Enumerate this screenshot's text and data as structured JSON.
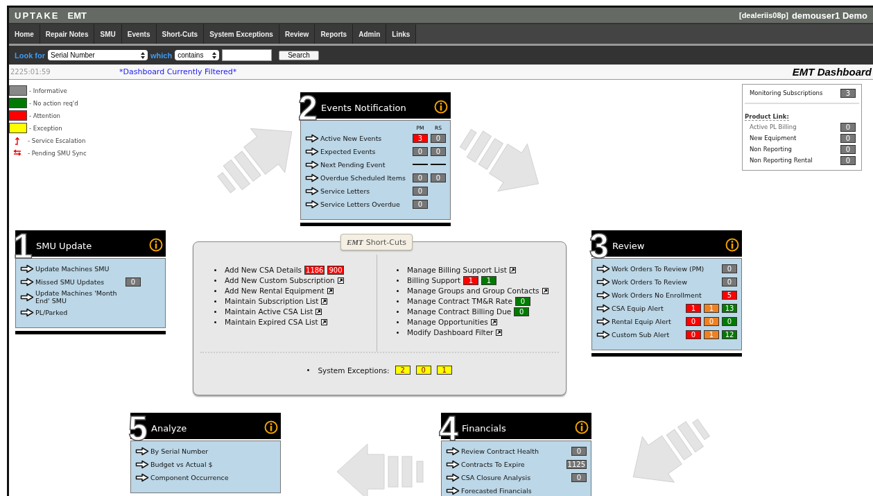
{
  "top_bar": {
    "logo": "UPTAKE",
    "product": "EMT",
    "account": "[dealeriis08p]",
    "user": "demouser1 Demo"
  },
  "nav": [
    "Home",
    "Repair Notes",
    "SMU",
    "Events",
    "Short-Cuts",
    "System Exceptions",
    "Review",
    "Reports",
    "Admin",
    "Links"
  ],
  "search": {
    "look_for_label": "Look for",
    "field": "Serial Number",
    "which_label": "which",
    "operator": "contains",
    "button": "Search"
  },
  "info_bar": {
    "time": "2225:01:59",
    "filter_notice": "*Dashboard Currently Filtered*",
    "title": "EMT Dashboard"
  },
  "legend": [
    {
      "kind": "swatch",
      "color": "#888888",
      "label": "- Informative"
    },
    {
      "kind": "swatch",
      "color": "#007a00",
      "label": "- No action req'd"
    },
    {
      "kind": "swatch",
      "color": "#ff0000",
      "label": "- Attention"
    },
    {
      "kind": "swatch",
      "color": "#ffff00",
      "label": "- Exception"
    },
    {
      "kind": "escalation",
      "label": "- Service Escalation"
    },
    {
      "kind": "sync",
      "label": "- Pending SMU Sync"
    }
  ],
  "monitoring": {
    "label": "Monitoring Subscriptions",
    "badge": {
      "kind": "count",
      "text": "3",
      "color": "#777777"
    },
    "product_link": {
      "title": "Product Link:",
      "rows": [
        {
          "label": "Active PL Billing",
          "disabled": true,
          "badge": {
            "kind": "count",
            "text": "0",
            "color": "#777777"
          }
        },
        {
          "label": "New Equipment",
          "disabled": false,
          "badge": {
            "kind": "count",
            "text": "0",
            "color": "#777777"
          }
        },
        {
          "label": "Non Reporting",
          "disabled": false,
          "badge": {
            "kind": "count",
            "text": "0",
            "color": "#777777"
          }
        },
        {
          "label": "Non Reporting Rental",
          "disabled": false,
          "badge": {
            "kind": "count",
            "text": "0",
            "color": "#777777"
          }
        }
      ]
    }
  },
  "panels": [
    {
      "number": "2",
      "title": "Events Notification",
      "columns": [
        "PM",
        "RS"
      ],
      "rows": [
        {
          "label": "Active New Events",
          "badges": [
            {
              "kind": "count",
              "text": "3",
              "color": "#ff0000"
            },
            {
              "kind": "count",
              "text": "0",
              "color": "#777777"
            }
          ]
        },
        {
          "label": "Expected Events",
          "badges": [
            {
              "kind": "count",
              "text": "0",
              "color": "#777777"
            },
            {
              "kind": "count",
              "text": "0",
              "color": "#777777"
            }
          ]
        },
        {
          "label": "Next Pending Event",
          "badges": [
            {
              "kind": "dash"
            },
            {
              "kind": "dash"
            }
          ]
        },
        {
          "label": "Overdue Scheduled Items",
          "badges": [
            {
              "kind": "count",
              "text": "0",
              "color": "#777777"
            },
            {
              "kind": "count",
              "text": "0",
              "color": "#777777"
            }
          ]
        },
        {
          "label": "Service Letters",
          "badges": [
            {
              "kind": "count",
              "text": "0",
              "color": "#777777"
            }
          ]
        },
        {
          "label": "Service Letters Overdue",
          "badges": [
            {
              "kind": "count",
              "text": "0",
              "color": "#777777"
            }
          ]
        }
      ]
    },
    {
      "number": "1",
      "title": "SMU Update",
      "rows": [
        {
          "label": "Update Machines SMU"
        },
        {
          "label": "Missed SMU Updates",
          "badges": [
            {
              "kind": "count",
              "text": "0",
              "color": "#777777"
            }
          ]
        },
        {
          "label": "Update Machines 'Month End' SMU"
        },
        {
          "label": "PL/Parked"
        }
      ]
    },
    {
      "number": "3",
      "title": "Review",
      "rows": [
        {
          "label": "Work Orders To Review (PM)",
          "badges": [
            {
              "kind": "count",
              "text": "0",
              "color": "#777777"
            }
          ]
        },
        {
          "label": "Work Orders To Review",
          "badges": [
            {
              "kind": "count",
              "text": "0",
              "color": "#777777"
            }
          ]
        },
        {
          "label": "Work Orders No Enrollment",
          "badges": [
            {
              "kind": "count",
              "text": "5",
              "color": "#ff0000"
            }
          ]
        },
        {
          "label": "CSA Equip Alert",
          "badges": [
            {
              "kind": "count",
              "text": "1",
              "color": "#ff0000"
            },
            {
              "kind": "count",
              "text": "1",
              "color": "#f08020"
            },
            {
              "kind": "count",
              "text": "13",
              "color": "#007a00"
            }
          ]
        },
        {
          "label": "Rental Equip Alert",
          "badges": [
            {
              "kind": "count",
              "text": "0",
              "color": "#ff0000"
            },
            {
              "kind": "count",
              "text": "0",
              "color": "#f08020"
            },
            {
              "kind": "count",
              "text": "0",
              "color": "#007a00"
            }
          ]
        },
        {
          "label": "Custom Sub Alert",
          "badges": [
            {
              "kind": "count",
              "text": "0",
              "color": "#ff0000"
            },
            {
              "kind": "count",
              "text": "1",
              "color": "#f08020"
            },
            {
              "kind": "count",
              "text": "12",
              "color": "#007a00"
            }
          ]
        }
      ]
    },
    {
      "number": "5",
      "title": "Analyze",
      "rows": [
        {
          "label": "By Serial Number"
        },
        {
          "label": "Budget vs Actual $"
        },
        {
          "label": "Component Occurrence"
        }
      ]
    },
    {
      "number": "4",
      "title": "Financials",
      "rows": [
        {
          "label": "Review Contract Health",
          "badges": [
            {
              "kind": "count",
              "text": "0",
              "color": "#777777"
            }
          ]
        },
        {
          "label": "Contracts To Expire",
          "badges": [
            {
              "kind": "count",
              "text": "1125",
              "color": "#777777"
            }
          ]
        },
        {
          "label": "CSA Closure Analysis",
          "badges": [
            {
              "kind": "count",
              "text": "0",
              "color": "#777777"
            }
          ]
        },
        {
          "label": "Forecasted Financials"
        }
      ]
    }
  ],
  "shortcuts": {
    "title": "**EMT** Short-Cuts",
    "left": [
      {
        "label": "Add New CSA Details",
        "link": false,
        "badges": [
          {
            "kind": "count",
            "text": "1186",
            "color": "#ff0000"
          },
          {
            "kind": "count",
            "text": "900",
            "color": "#ff0000"
          }
        ]
      },
      {
        "label": "Add New Custom Subscription",
        "link": true
      },
      {
        "label": "Add New Rental Equipment",
        "link": true
      },
      {
        "label": "Maintain Subscription List",
        "link": true
      },
      {
        "label": "Maintain Active CSA List",
        "link": true
      },
      {
        "label": "Maintain Expired CSA List",
        "link": true
      }
    ],
    "right": [
      {
        "label": "Manage Billing Support List",
        "link": true
      },
      {
        "label": "Billing Support",
        "link": false,
        "badges": [
          {
            "kind": "count",
            "text": "1",
            "color": "#ff0000"
          },
          {
            "kind": "count",
            "text": "1",
            "color": "#007a00"
          }
        ]
      },
      {
        "label": "Manage Groups and Group Contacts",
        "link": true
      },
      {
        "label": "Manage Contract TM&R Rate",
        "link": false,
        "badges": [
          {
            "kind": "count",
            "text": "0",
            "color": "#007a00"
          }
        ]
      },
      {
        "label": "Manage Contract Billing Due",
        "link": false,
        "badges": [
          {
            "kind": "count",
            "text": "0",
            "color": "#007a00"
          }
        ]
      },
      {
        "label": "Manage Opportunities",
        "link": true
      },
      {
        "label": "Modify Dashboard Filter",
        "link": true
      }
    ],
    "exceptions": {
      "label": "System Exceptions:",
      "badges": [
        {
          "kind": "count",
          "text": "2",
          "color": "#ffff00"
        },
        {
          "kind": "count",
          "text": "0",
          "color": "#ffff00"
        },
        {
          "kind": "count",
          "text": "1",
          "color": "#ffff00"
        }
      ]
    }
  }
}
